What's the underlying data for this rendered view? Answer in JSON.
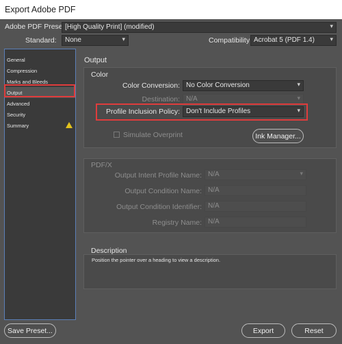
{
  "window": {
    "title": "Export Adobe PDF"
  },
  "header": {
    "preset_label": "Adobe PDF Preset:",
    "preset_value": "[High Quality Print] (modified)",
    "standard_label": "Standard:",
    "standard_value": "None",
    "compat_label": "Compatibility:",
    "compat_value": "Acrobat 5 (PDF 1.4)"
  },
  "sidebar": {
    "items": [
      {
        "label": "General"
      },
      {
        "label": "Compression"
      },
      {
        "label": "Marks and Bleeds"
      },
      {
        "label": "Output"
      },
      {
        "label": "Advanced"
      },
      {
        "label": "Security"
      },
      {
        "label": "Summary"
      }
    ]
  },
  "main": {
    "section_title": "Output",
    "color": {
      "title": "Color",
      "conversion_label": "Color Conversion:",
      "conversion_value": "No Color Conversion",
      "destination_label": "Destination:",
      "destination_value": "N/A",
      "profile_label": "Profile Inclusion Policy:",
      "profile_value": "Don't Include Profiles",
      "simulate_label": "Simulate Overprint",
      "ink_manager_label": "Ink Manager..."
    },
    "pdfx": {
      "title": "PDF/X",
      "intent_label": "Output Intent Profile Name:",
      "intent_value": "N/A",
      "condition_label": "Output Condition Name:",
      "condition_value": "N/A",
      "identifier_label": "Output Condition Identifier:",
      "identifier_value": "N/A",
      "registry_label": "Registry Name:",
      "registry_value": "N/A"
    },
    "description": {
      "title": "Description",
      "text": "Position the pointer over a heading to view a description."
    }
  },
  "footer": {
    "save_preset": "Save Preset...",
    "export": "Export",
    "reset": "Reset"
  },
  "icons": {
    "dropdown": "▾",
    "warning": "warning-icon"
  },
  "colors": {
    "background": "#535353",
    "panel": "#4a4a4a",
    "highlight": "#e03c3c",
    "sidebar_border": "#5b7fb8",
    "warning": "#e3c21d"
  }
}
